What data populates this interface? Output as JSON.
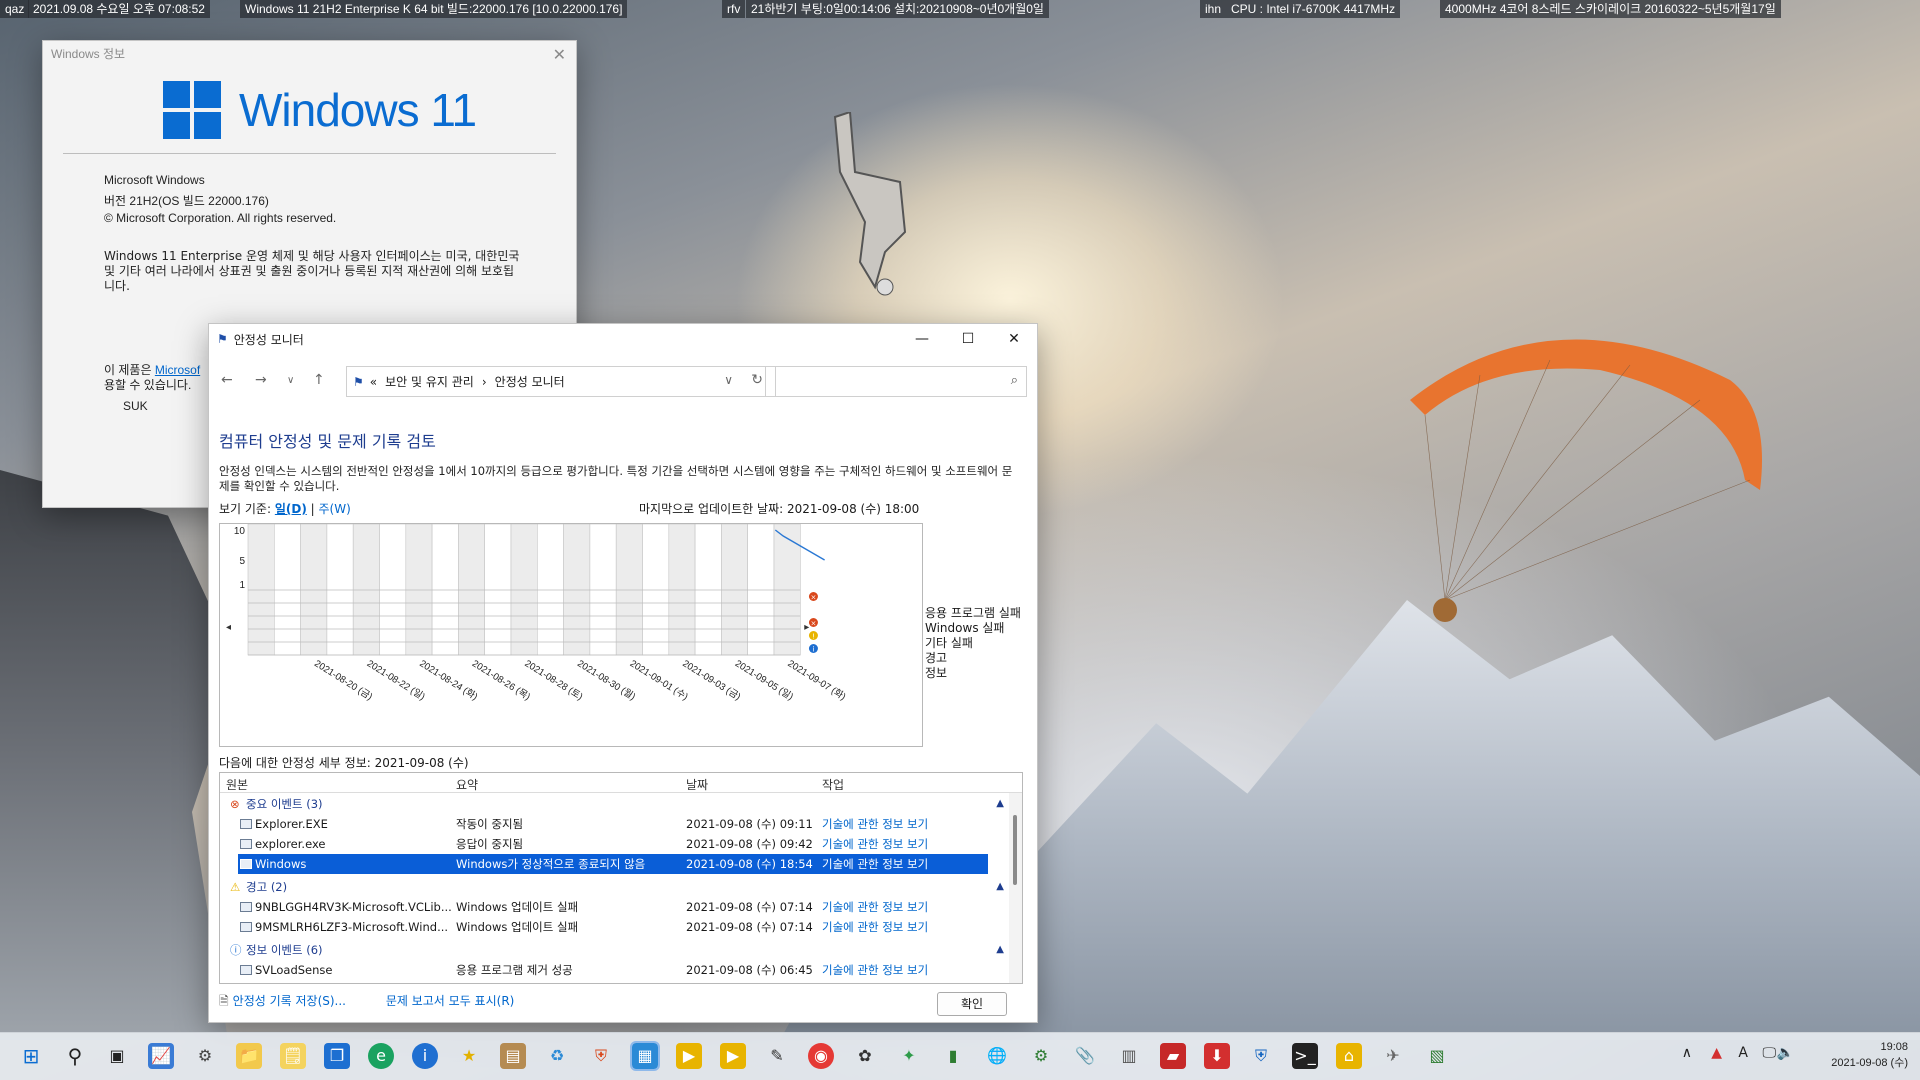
{
  "info_bar": {
    "host": "qaz",
    "datetime": "2021.09.08 수요일 오후 07:08:52",
    "os": "Windows 11 21H2 Enterprise K 64 bit 빌드:22000.176 [10.0.22000.176]",
    "rfv": "rfv",
    "boot": "21하반기 부팅:0일00:14:06 설치:20210908~0년0개월0일",
    "ihn": "ihn",
    "cpu": "CPU : Intel i7-6700K 4417MHz",
    "cpu2": "4000MHz 4코어 8스레드 스카이레이크 20160322~5년5개월17일"
  },
  "about": {
    "title": "Windows 정보",
    "logo_text": "Windows 11",
    "product": "Microsoft Windows",
    "version": "버전 21H2(OS 빌드 22000.176)",
    "copyright": "© Microsoft Corporation. All rights reserved.",
    "desc": "Windows 11 Enterprise 운영 체제 및 해당 사용자 인터페이스는 미국, 대한민국 및 기타 여러 나라에서 상표권 및 출원 중이거나 등록된 지적 재산권에 의해 보호됩니다.",
    "license_pre": "이 제품은 ",
    "license_link": "Microsof",
    "license_post": "용할 수 있습니다.",
    "user": "SUK"
  },
  "monitor": {
    "title": "안정성 모니터",
    "breadcrumb": [
      "«",
      "보안 및 유지 관리",
      "›",
      "안정성 모니터"
    ],
    "heading": "컴퓨터 안정성 및 문제 기록 검토",
    "description": "안정성 인덱스는 시스템의 전반적인 안정성을 1에서 10까지의 등급으로 평가합니다. 특정 기간을 선택하면 시스템에 영향을 주는 구체적인 하드웨어 및 소프트웨어 문제를 확인할 수 있습니다.",
    "view_by_label": "보기 기준: ",
    "view_day": "일(D)",
    "view_sep": " | ",
    "view_week": "주(W)",
    "last_updated": "마지막으로 업데이트한 날짜: 2021-09-08 (수) 18:00",
    "details_label": "다음에 대한 안정성 세부 정보: 2021-09-08 (수)",
    "columns": {
      "source": "원본",
      "summary": "요약",
      "date": "날짜",
      "action": "작업"
    },
    "groups": [
      {
        "label": "중요 이벤트 (3)"
      },
      {
        "label": "경고 (2)"
      },
      {
        "label": "정보 이벤트 (6)"
      }
    ],
    "rows": [
      {
        "source": "Explorer.EXE",
        "summary": "작동이 중지됨",
        "date": "2021-09-08 (수) 09:11",
        "action": "기술에 관한 정보 보기"
      },
      {
        "source": "explorer.exe",
        "summary": "응답이 중지됨",
        "date": "2021-09-08 (수) 09:42",
        "action": "기술에 관한 정보 보기"
      },
      {
        "source": "Windows",
        "summary": "Windows가 정상적으로 종료되지 않음",
        "date": "2021-09-08 (수) 18:54",
        "action": "기술에 관한 정보 보기"
      },
      {
        "source": "9NBLGGH4RV3K-Microsoft.VCLib...",
        "summary": "Windows 업데이트 실패",
        "date": "2021-09-08 (수) 07:14",
        "action": "기술에 관한 정보 보기"
      },
      {
        "source": "9MSMLRH6LZF3-Microsoft.Wind...",
        "summary": "Windows 업데이트 실패",
        "date": "2021-09-08 (수) 07:14",
        "action": "기술에 관한 정보 보기"
      },
      {
        "source": "SVLoadSense",
        "summary": "응용 프로그램 제거 성공",
        "date": "2021-09-08 (수) 06:45",
        "action": "기술에 관한 정보 보기"
      }
    ],
    "footer": {
      "save": "안정성 기록 저장(S)...",
      "show_all": "문제 보고서 모두 표시(R)",
      "ok": "확인"
    }
  },
  "chart_data": {
    "type": "line",
    "title": "",
    "ylabel": "",
    "ylim": [
      1,
      10
    ],
    "y_ticks": [
      "10",
      "5",
      "1"
    ],
    "x_tick_labels": [
      "2021-08-20 (금)",
      "2021-08-22 (일)",
      "2021-08-24 (화)",
      "2021-08-26 (목)",
      "2021-08-28 (토)",
      "2021-08-30 (월)",
      "2021-09-01 (수)",
      "2021-09-03 (금)",
      "2021-09-05 (일)",
      "2021-09-07 (화)"
    ],
    "stability_index": {
      "x": [
        "2021-09-07",
        "2021-09-07",
        "2021-09-08"
      ],
      "y": [
        10,
        9,
        5
      ]
    },
    "selected_day": "2021-09-08",
    "event_rows": [
      "응용 프로그램 실패",
      "Windows 실패",
      "기타 실패",
      "경고",
      "정보"
    ],
    "events_selected_day": {
      "응용 프로그램 실패": "error",
      "기타 실패": "error",
      "경고": "warning",
      "정보": "info"
    },
    "grid": true,
    "legend_position": "right"
  },
  "taskbar": {
    "time": "19:08",
    "date": "2021-09-08 (수)",
    "lang": "A"
  },
  "colors": {
    "accent": "#0a5ed7",
    "windows_blue": "#0a6cd1",
    "heading": "#1e3d8f",
    "link": "#0066cc",
    "error": "#d9481c",
    "warning": "#e8b400",
    "info": "#1f6fd1"
  }
}
